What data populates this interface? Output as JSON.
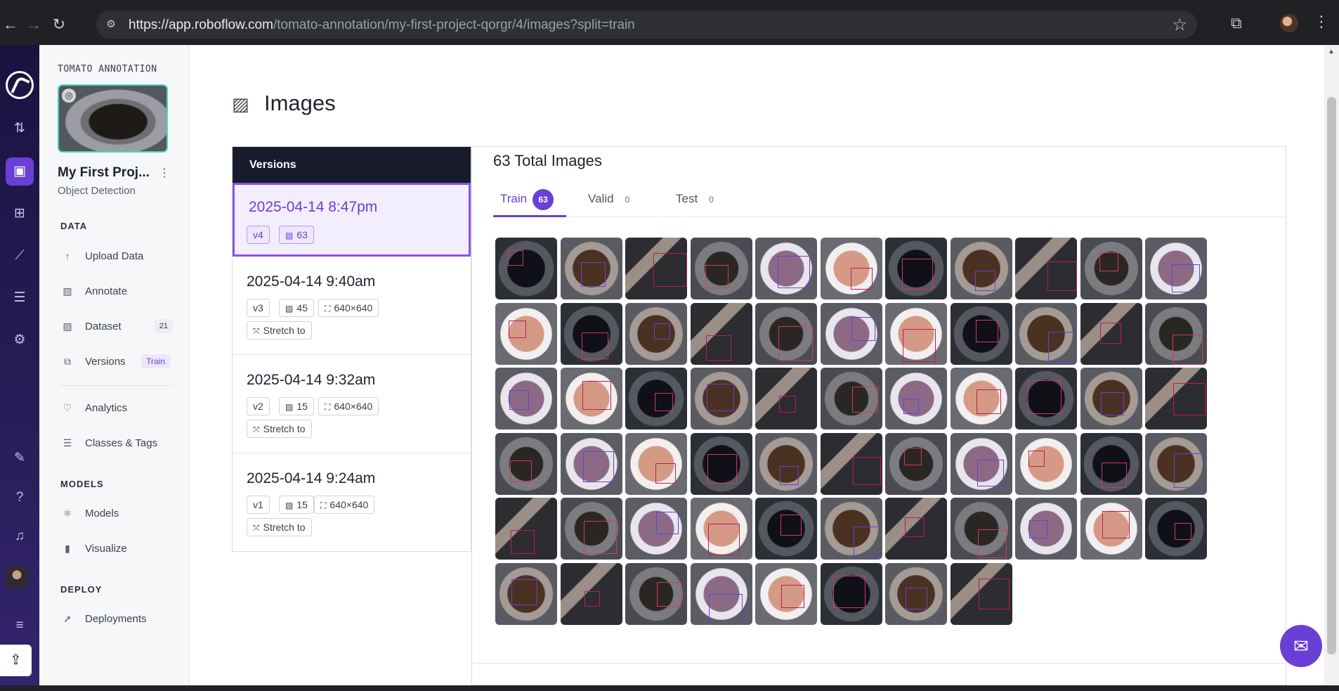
{
  "browser": {
    "url_host": "https://app.roboflow.com",
    "url_path": "/tomato-annotation/my-first-project-qorgr/4/images?split=train"
  },
  "workspace_label": "TOMATO ANNOTATION",
  "project": {
    "name": "My First Proj...",
    "type": "Object Detection"
  },
  "sidebar": {
    "data_heading": "DATA",
    "upload": "Upload Data",
    "annotate": "Annotate",
    "dataset": "Dataset",
    "dataset_count": "21",
    "versions": "Versions",
    "versions_badge": "Train",
    "analytics": "Analytics",
    "classes": "Classes & Tags",
    "models_heading": "MODELS",
    "models": "Models",
    "visualize": "Visualize",
    "deploy_heading": "DEPLOY",
    "deployments": "Deployments"
  },
  "page_title": "Images",
  "versions_panel": {
    "heading": "Versions",
    "items": [
      {
        "date": "2025-04-14 8:47pm",
        "version": "v4",
        "images": "63",
        "size": "",
        "resize": ""
      },
      {
        "date": "2025-04-14 9:40am",
        "version": "v3",
        "images": "45",
        "size": "640×640",
        "resize": "Stretch to"
      },
      {
        "date": "2025-04-14 9:32am",
        "version": "v2",
        "images": "15",
        "size": "640×640",
        "resize": "Stretch to"
      },
      {
        "date": "2025-04-14 9:24am",
        "version": "v1",
        "images": "15",
        "size": "640×640",
        "resize": "Stretch to"
      }
    ]
  },
  "gallery": {
    "total": "63 Total Images",
    "tabs": [
      {
        "label": "Train",
        "count": "63"
      },
      {
        "label": "Valid",
        "count": "0"
      },
      {
        "label": "Test",
        "count": "0"
      }
    ],
    "image_count": 63
  },
  "colors": {
    "accent": "#6a3fd6",
    "header_dark": "#171b2c"
  }
}
